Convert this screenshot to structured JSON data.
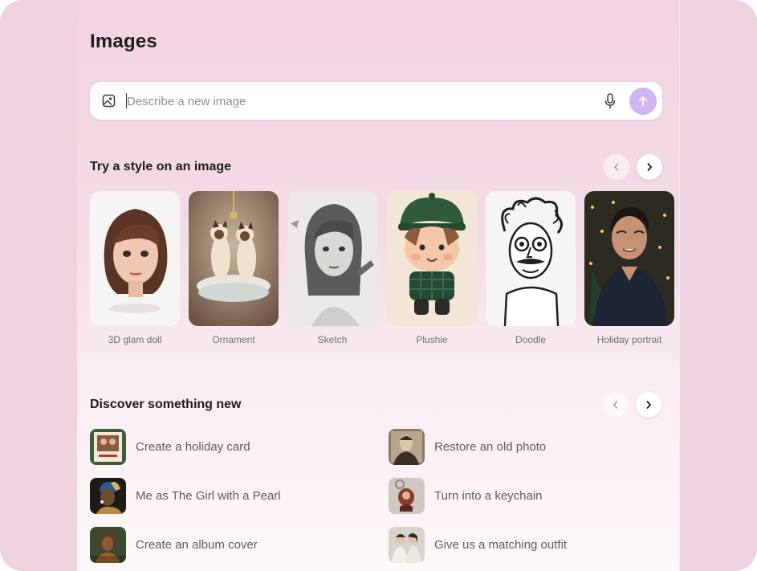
{
  "page": {
    "title": "Images"
  },
  "search": {
    "placeholder": "Describe a new image"
  },
  "styles_section": {
    "title": "Try a style on an image",
    "items": [
      {
        "label": "3D glam doll",
        "icon": "3d-glam-doll-thumbnail"
      },
      {
        "label": "Ornament",
        "icon": "ornament-thumbnail"
      },
      {
        "label": "Sketch",
        "icon": "sketch-thumbnail"
      },
      {
        "label": "Plushie",
        "icon": "plushie-thumbnail"
      },
      {
        "label": "Doodle",
        "icon": "doodle-thumbnail"
      },
      {
        "label": "Holiday portrait",
        "icon": "holiday-portrait-thumbnail"
      }
    ]
  },
  "discover_section": {
    "title": "Discover something new",
    "items": [
      {
        "label": "Create a holiday card",
        "icon": "holiday-card-thumbnail"
      },
      {
        "label": "Restore an old photo",
        "icon": "old-photo-thumbnail"
      },
      {
        "label": "Me as The Girl with a Pearl",
        "icon": "girl-with-pearl-thumbnail"
      },
      {
        "label": "Turn into a keychain",
        "icon": "keychain-thumbnail"
      },
      {
        "label": "Create an album cover",
        "icon": "album-cover-thumbnail"
      },
      {
        "label": "Give us a matching outfit",
        "icon": "matching-outfit-thumbnail"
      }
    ]
  },
  "colors": {
    "send_button": "#cdb6f3",
    "page_background": "#efd2df"
  }
}
